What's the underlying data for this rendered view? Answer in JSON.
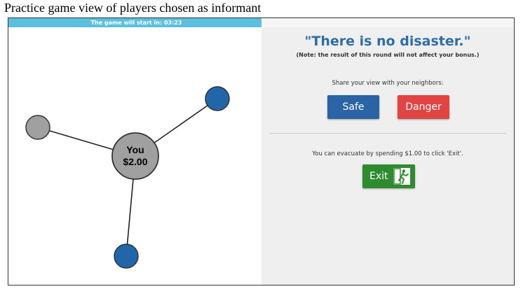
{
  "caption": "Practice game view of players chosen as informant",
  "timer": {
    "text": "The game will start in: 03:23",
    "fill_fraction": 1.0
  },
  "network": {
    "self_label": "You",
    "self_balance": "$2.00",
    "colors": {
      "self": "#a0a0a0",
      "gray_neighbor": "#a0a0a0",
      "blue_neighbor": "#2266aa",
      "edge": "#222222"
    }
  },
  "panel": {
    "headline": "\"There is no disaster.\"",
    "note": "(Note: the result of this round will not affect your bonus.)",
    "share_prompt": "Share your view with your neighbors:",
    "safe_label": "Safe",
    "danger_label": "Danger",
    "evacuate_text": "You can evacuate by spending $1.00 to click 'Exit'.",
    "exit_label": "Exit"
  },
  "colors": {
    "safe": "#2a64a4",
    "danger": "#e24444",
    "exit": "#2e8b30",
    "headline": "#2f6da8",
    "timer": "#5bc0de"
  }
}
